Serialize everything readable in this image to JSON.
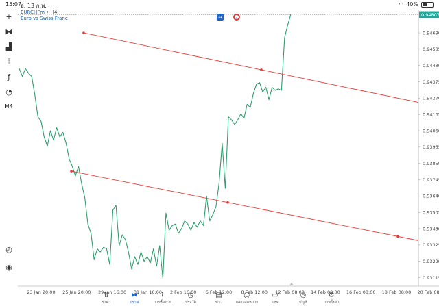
{
  "status": {
    "time": "15:07",
    "date": "อ. 13 ก.พ.",
    "battery": "40%"
  },
  "header": {
    "symbol": "EURCHFm",
    "timeframe": "• H4",
    "description": "Euro vs Swiss Franc"
  },
  "left_tools": [
    {
      "icon": "crosshair-icon",
      "glyph": "+"
    },
    {
      "icon": "candlestick-icon",
      "glyph": "⧓"
    },
    {
      "icon": "chart-add-icon",
      "glyph": "▟"
    },
    {
      "icon": "indicators-icon",
      "glyph": "⫶"
    },
    {
      "icon": "function-icon",
      "glyph": "ƒ"
    },
    {
      "icon": "shapes-icon",
      "glyph": "◔"
    },
    {
      "icon": "timeframe-icon",
      "glyph": "H4"
    }
  ],
  "bottom_left_tools": [
    {
      "icon": "speedometer-icon",
      "glyph": "◴"
    },
    {
      "icon": "broker-logo-icon",
      "glyph": "◉"
    }
  ],
  "chart_data": {
    "type": "line",
    "current_price": "0.94807",
    "y_ticks": [
      "0.94690",
      "0.94585",
      "0.94480",
      "0.94375",
      "0.94270",
      "0.94165",
      "0.94060",
      "0.93955",
      "0.93850",
      "0.93745",
      "0.93640",
      "0.93535",
      "0.93430",
      "0.93325",
      "0.93220",
      "0.93115"
    ],
    "x_ticks": [
      "23 Jan 20:00",
      "25 Jan 20:00",
      "29 Jan 16:00",
      "31 Jan 16:00",
      "2 Feb 16:00",
      "6 Feb 12:00",
      "8 Feb 12:00",
      "12 Feb 08:00",
      "14 Feb 08:00",
      "16 Feb 08:00",
      "18 Feb 08:00",
      "20 Feb 08:00"
    ],
    "ylim": [
      0.9306,
      0.9484
    ],
    "series": [
      {
        "values": [
          0.9446,
          0.9441,
          0.9446,
          0.9443,
          0.9441,
          0.9429,
          0.9415,
          0.9412,
          0.9402,
          0.9396,
          0.9406,
          0.94,
          0.9408,
          0.9402,
          0.9405,
          0.9398,
          0.9388,
          0.9383,
          0.9377,
          0.9383,
          0.9372,
          0.9363,
          0.9346,
          0.934,
          0.9323,
          0.933,
          0.9328,
          0.9331,
          0.933,
          0.932,
          0.9355,
          0.9358,
          0.9332,
          0.9339,
          0.9336,
          0.9328,
          0.9317,
          0.9325,
          0.932,
          0.9328,
          0.9322,
          0.9325,
          0.9321,
          0.933,
          0.9319,
          0.9332,
          0.9311,
          0.9353,
          0.9342,
          0.9345,
          0.9346,
          0.934,
          0.9343,
          0.9348,
          0.9346,
          0.9342,
          0.9347,
          0.9344,
          0.9348,
          0.9345,
          0.9364,
          0.9348,
          0.9352,
          0.9357,
          0.9372,
          0.9398,
          0.9369,
          0.9415,
          0.9413,
          0.941,
          0.9413,
          0.9417,
          0.9414,
          0.9423,
          0.9421,
          0.943,
          0.9436,
          0.9437,
          0.9431,
          0.9434,
          0.9426,
          0.9434,
          0.9432,
          0.9433,
          0.9432,
          0.9466,
          0.9474,
          0.9481
        ]
      }
    ],
    "trend_lines": [
      {
        "from": [
          0.0,
          0.9469
        ],
        "to": [
          1.0,
          0.9427
        ],
        "color": "#e53935"
      },
      {
        "from": [
          0.0,
          0.938
        ],
        "to": [
          1.0,
          0.9338
        ],
        "color": "#e53935"
      }
    ],
    "line_color": "#2e9e6e",
    "price_line_color": "#26a69a",
    "price_label_bg": "#26a69a"
  },
  "tabs": [
    {
      "label": "ราคา",
      "icon": "quotes-icon",
      "glyph": "⇅"
    },
    {
      "label": "กราฟ",
      "icon": "chart-icon",
      "glyph": "⧓",
      "active": true
    },
    {
      "label": "การซื้อขาย",
      "icon": "trade-icon",
      "glyph": "⌇"
    },
    {
      "label": "ประวัติ",
      "icon": "history-icon",
      "glyph": "◷"
    },
    {
      "label": "ข่าว",
      "icon": "news-icon",
      "glyph": "▤"
    },
    {
      "label": "กล่องจดหมาย",
      "icon": "mailbox-icon",
      "glyph": "@"
    },
    {
      "label": "แชท",
      "icon": "chat-icon",
      "glyph": "▭"
    },
    {
      "label": "บัญชี",
      "icon": "account-icon",
      "glyph": "◎"
    },
    {
      "label": "การตั้งค่า",
      "icon": "settings-icon",
      "glyph": "⚙"
    }
  ]
}
